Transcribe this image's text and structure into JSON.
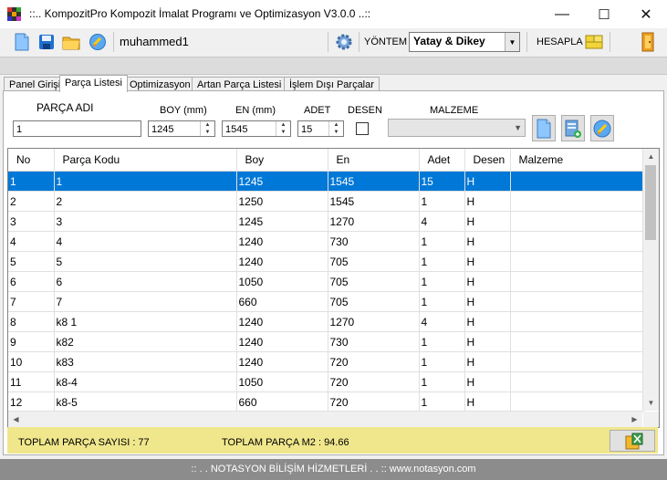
{
  "window": {
    "title": "::.. KompozitPro Kompozit İmalat Programı ve Optimizasyon V3.0.0 ..::",
    "minimize": "—",
    "maximize": "☐",
    "close": "✕"
  },
  "toolbar": {
    "user": "muhammed1",
    "yontem_label": "YÖNTEM",
    "yontem_value": "Yatay & Dikey",
    "hesapla_label": "HESAPLA"
  },
  "tabs": [
    {
      "label": "Panel Girişi"
    },
    {
      "label": "Parça Listesi"
    },
    {
      "label": "Optimizasyon"
    },
    {
      "label": "Artan Parça Listesi"
    },
    {
      "label": "İşlem Dışı Parçalar"
    }
  ],
  "form": {
    "parca_adi_label": "PARÇA ADI",
    "parca_adi_value": "1",
    "boy_label": "BOY (mm)",
    "boy_value": "1245",
    "en_label": "EN (mm)",
    "en_value": "1545",
    "adet_label": "ADET",
    "adet_value": "15",
    "desen_label": "DESEN",
    "malzeme_label": "MALZEME"
  },
  "table": {
    "columns": [
      "No",
      "Parça Kodu",
      "Boy",
      "En",
      "Adet",
      "Desen",
      "Malzeme"
    ],
    "rows": [
      [
        "1",
        "1",
        "1245",
        "1545",
        "15",
        "H",
        ""
      ],
      [
        "2",
        "2",
        "1250",
        "1545",
        "1",
        "H",
        ""
      ],
      [
        "3",
        "3",
        "1245",
        "1270",
        "4",
        "H",
        ""
      ],
      [
        "4",
        "4",
        "1240",
        "730",
        "1",
        "H",
        ""
      ],
      [
        "5",
        "5",
        "1240",
        "705",
        "1",
        "H",
        ""
      ],
      [
        "6",
        "6",
        "1050",
        "705",
        "1",
        "H",
        ""
      ],
      [
        "7",
        "7",
        "660",
        "705",
        "1",
        "H",
        ""
      ],
      [
        "8",
        "k8 1",
        "1240",
        "1270",
        "4",
        "H",
        ""
      ],
      [
        "9",
        "k82",
        "1240",
        "730",
        "1",
        "H",
        ""
      ],
      [
        "10",
        "k83",
        "1240",
        "720",
        "1",
        "H",
        ""
      ],
      [
        "11",
        "k8-4",
        "1050",
        "720",
        "1",
        "H",
        ""
      ],
      [
        "12",
        "k8-5",
        "660",
        "720",
        "1",
        "H",
        ""
      ]
    ]
  },
  "footer": {
    "toplam_sayi": "TOPLAM PARÇA SAYISI : 77",
    "toplam_m2": "TOPLAM PARÇA M2 : 94.66"
  },
  "status": {
    "text": ":: . . NOTASYON BİLİŞİM HİZMETLERİ . . ::    www.notasyon.com"
  },
  "colors": {
    "selection": "#0078d7",
    "footer_bg": "#f0e68c",
    "status_bg": "#8c8c8c"
  }
}
